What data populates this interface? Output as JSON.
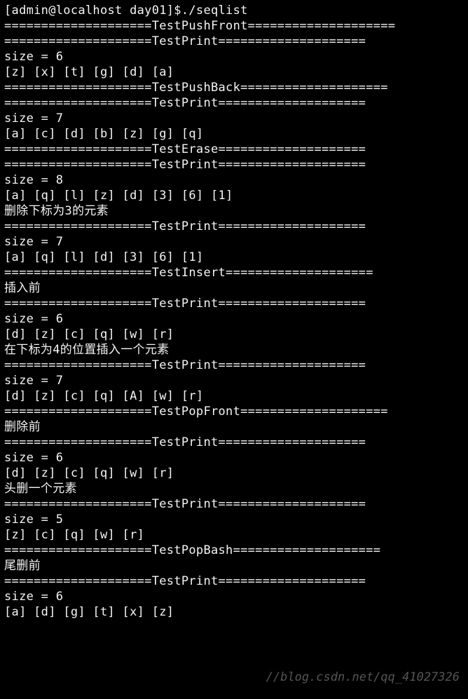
{
  "prompt": "[admin@localhost day01]$./seqlist",
  "lines": [
    "====================TestPushFront====================",
    "====================TestPrint====================",
    "size = 6",
    "[z] [x] [t] [g] [d] [a]",
    "====================TestPushBack====================",
    "====================TestPrint====================",
    "size = 7",
    "[a] [c] [d] [b] [z] [g] [q]",
    "====================TestErase====================",
    "====================TestPrint====================",
    "size = 8",
    "[a] [q] [l] [z] [d] [3] [6] [1]",
    "删除下标为3的元素",
    "====================TestPrint====================",
    "size = 7",
    "[a] [q] [l] [d] [3] [6] [1]",
    "====================TestInsert====================",
    "插入前",
    "====================TestPrint====================",
    "size = 6",
    "[d] [z] [c] [q] [w] [r]",
    "在下标为4的位置插入一个元素",
    "====================TestPrint====================",
    "size = 7",
    "[d] [z] [c] [q] [A] [w] [r]",
    "====================TestPopFront====================",
    "删除前",
    "====================TestPrint====================",
    "size = 6",
    "[d] [z] [c] [q] [w] [r]",
    "头删一个元素",
    "====================TestPrint====================",
    "size = 5",
    "[z] [c] [q] [w] [r]",
    "====================TestPopBash====================",
    "尾删前",
    "====================TestPrint====================",
    "size = 6",
    "[a] [d] [g] [t] [x] [z]"
  ],
  "watermark": "//blog.csdn.net/qq_41027326"
}
